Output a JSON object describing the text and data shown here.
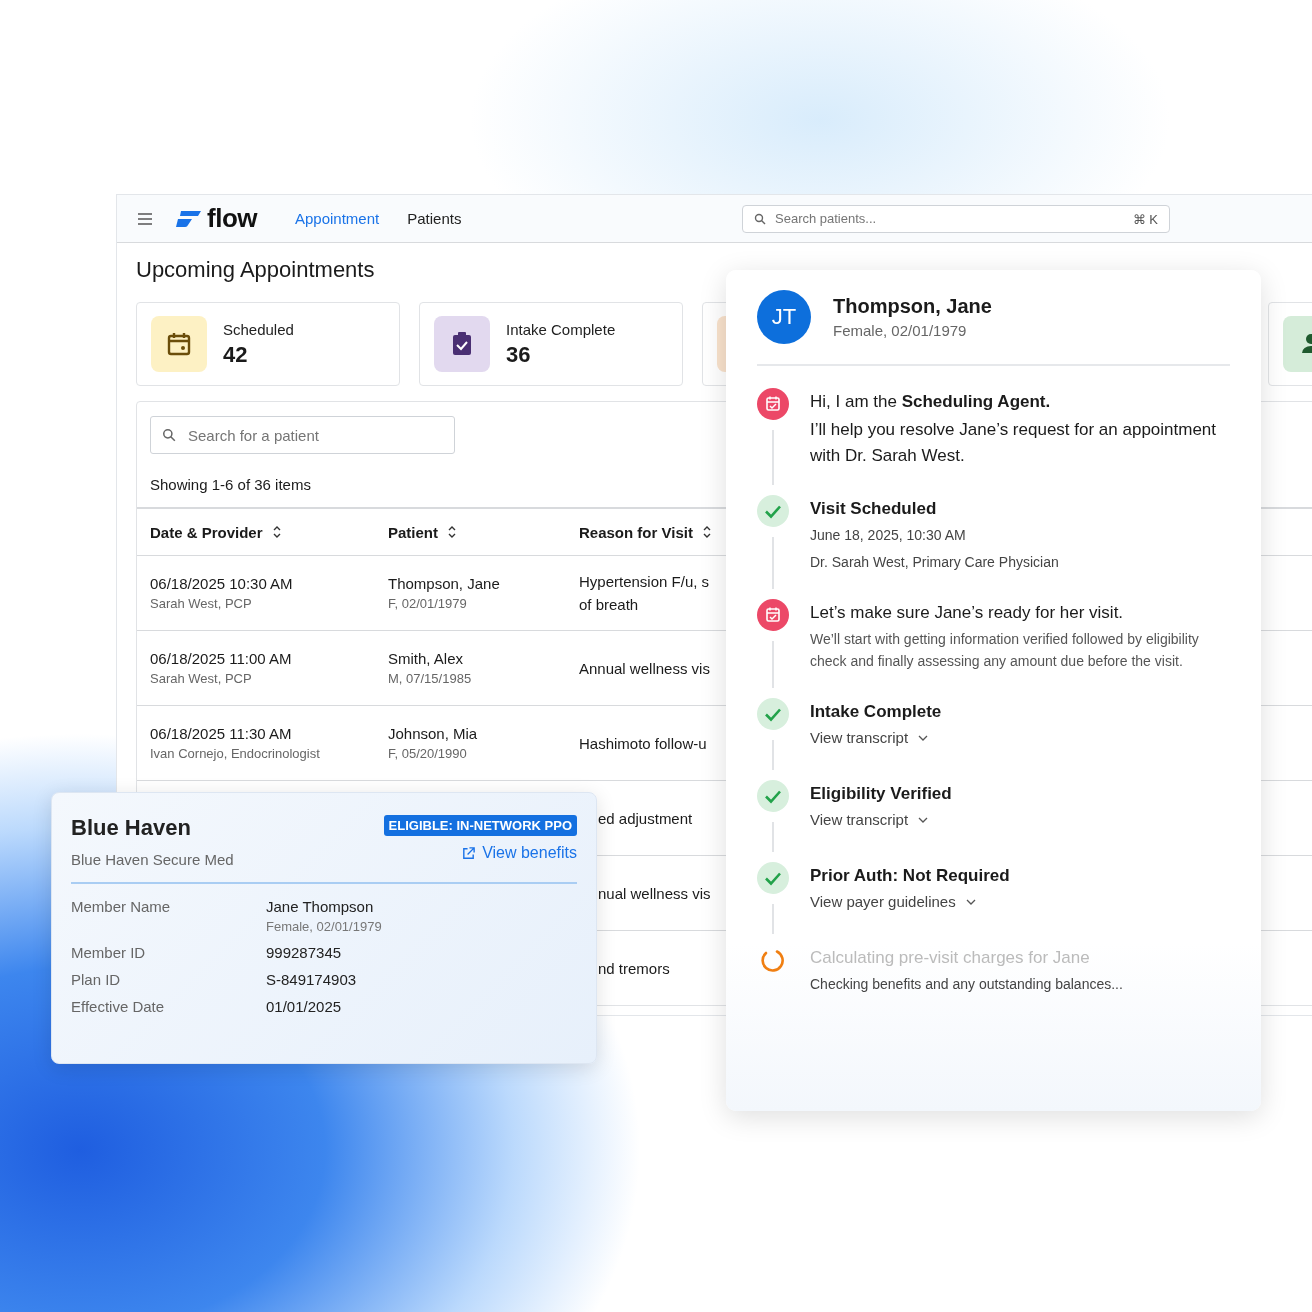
{
  "nav": {
    "logo": "flow",
    "tabs": [
      {
        "label": "Appointment",
        "selected": true
      },
      {
        "label": "Patients",
        "selected": false
      }
    ],
    "search": {
      "placeholder": "Search patients...",
      "shortcut": "⌘ K"
    }
  },
  "page": {
    "title": "Upcoming Appointments",
    "stats": [
      {
        "kind": "calendar",
        "label": "Scheduled",
        "count": "42"
      },
      {
        "kind": "clipboard",
        "label": "Intake Complete",
        "count": "36"
      },
      {
        "kind": "partial"
      },
      {
        "kind": "person"
      }
    ],
    "search": {
      "placeholder": "Search for a patient"
    },
    "showing": "Showing 1-6 of 36 items",
    "table": {
      "columns": [
        "Date & Provider",
        "Patient",
        "Reason for Visit"
      ],
      "rows": [
        {
          "date": "06/18/2025 10:30 AM",
          "provider": "Sarah West, PCP",
          "patient": "Thompson, Jane",
          "patient_info": "F, 02/01/1979",
          "reason": [
            "Hypertension F/u, s",
            "of breath"
          ]
        },
        {
          "date": "06/18/2025 11:00 AM",
          "provider": "Sarah West, PCP",
          "patient": "Smith, Alex",
          "patient_info": "M, 07/15/1985",
          "reason": [
            "Annual wellness vis"
          ]
        },
        {
          "date": "06/18/2025 11:30 AM",
          "provider": "Ivan Cornejo, Endocrinologist",
          "patient": "Johnson, Mia",
          "patient_info": "F, 05/20/1990",
          "reason": [
            "Hashimoto follow-u"
          ]
        },
        {
          "reason": [
            "ed adjustment"
          ]
        },
        {
          "reason": [
            "nual wellness vis"
          ]
        },
        {
          "reason": [
            "nd tremors"
          ]
        }
      ]
    }
  },
  "insurance": {
    "payer": "Blue Haven",
    "plan": "Blue Haven Secure Med",
    "badge": "ELIGIBLE: IN-NETWORK PPO",
    "link": "View benefits",
    "fields": [
      {
        "label": "Member Name",
        "value": "Jane Thompson",
        "sub": "Female, 02/01/1979"
      },
      {
        "label": "Member ID",
        "value": "999287345"
      },
      {
        "label": "Plan ID",
        "value": "S-849174903"
      },
      {
        "label": "Effective Date",
        "value": "01/01/2025"
      }
    ]
  },
  "patient_panel": {
    "initials": "JT",
    "name": "Thompson, Jane",
    "info": "Female, 02/01/1979",
    "steps": [
      {
        "kind": "intro",
        "title": "Hi, I am the **Scheduling Agent.**",
        "details": [
          "I’ll help you resolve Jane’s request for an appointment with Dr. Sarah West."
        ]
      },
      {
        "kind": "done",
        "title": "Visit Scheduled",
        "details": [
          "June 18, 2025, 10:30 AM",
          "Dr. Sarah West, Primary Care Physician"
        ]
      },
      {
        "kind": "agent",
        "title": "Let’s make sure Jane’s ready for her visit.",
        "details": [
          "We’ll start with getting information verified followed by eligibility check and finally assessing any amount due before the visit."
        ]
      },
      {
        "kind": "done",
        "title": "Intake Complete",
        "link": "View transcript"
      },
      {
        "kind": "done",
        "title": "Eligibility Verified",
        "link": "View transcript"
      },
      {
        "kind": "done",
        "title": "Prior Auth: Not Required",
        "link": "View payer guidelines"
      },
      {
        "kind": "pending",
        "title": "Calculating pre-visit charges for Jane",
        "details": [
          "Checking benefits and any outstanding balances..."
        ]
      }
    ]
  }
}
